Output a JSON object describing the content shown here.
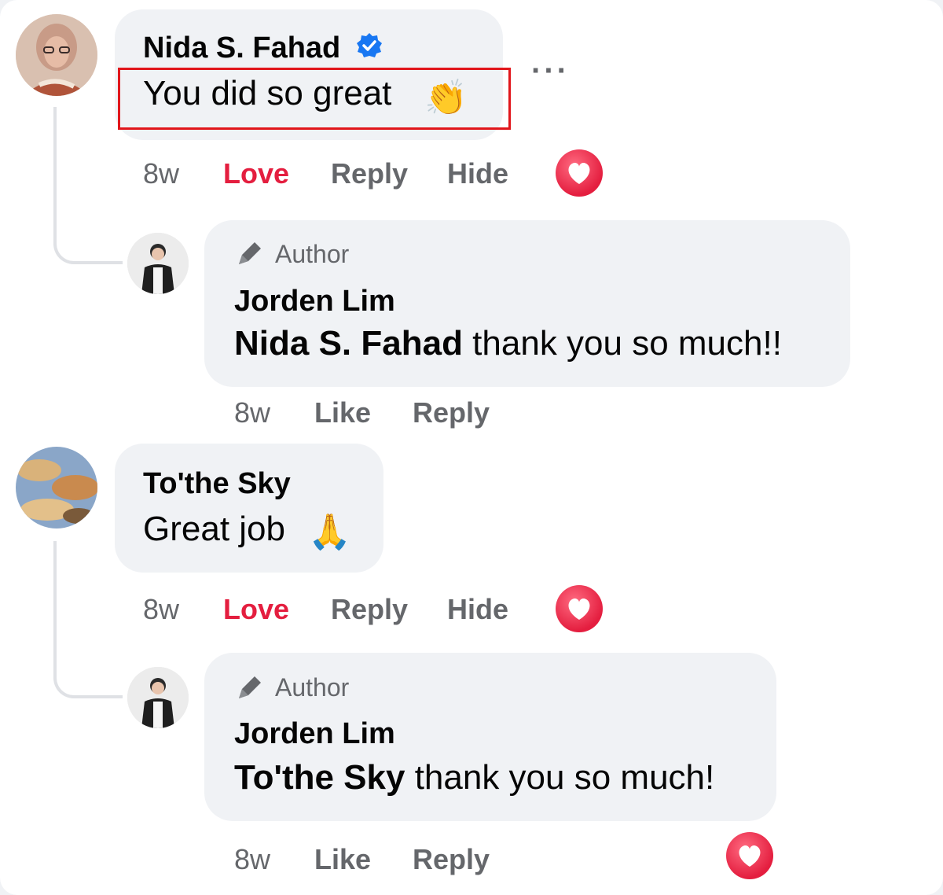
{
  "comments": [
    {
      "author": "Nida S. Fahad",
      "verified": true,
      "text": "You did so great",
      "emoji": "👏",
      "time": "8w",
      "react_label": "Love",
      "reply_label": "Reply",
      "hide_label": "Hide",
      "reply": {
        "badge": "Author",
        "author": "Jorden Lim",
        "mention": "Nida S. Fahad",
        "text": " thank you so much!!",
        "time": "8w",
        "like_label": "Like",
        "reply_label": "Reply"
      }
    },
    {
      "author": "To'the Sky",
      "verified": false,
      "text": "Great job",
      "emoji": "🙏",
      "time": "8w",
      "react_label": "Love",
      "reply_label": "Reply",
      "hide_label": "Hide",
      "reply": {
        "badge": "Author",
        "author": "Jorden Lim",
        "mention": "To'the Sky",
        "text": " thank you so much!",
        "time": "8w",
        "like_label": "Like",
        "reply_label": "Reply"
      }
    }
  ],
  "colors": {
    "love": "#e41e3f",
    "verified": "#1877f2",
    "highlight": "#e1161b",
    "bubble": "#f0f2f5",
    "meta": "#65676b"
  },
  "icons": [
    "verified-badge-icon",
    "more-options-icon",
    "pen-author-icon",
    "love-reaction-icon"
  ]
}
